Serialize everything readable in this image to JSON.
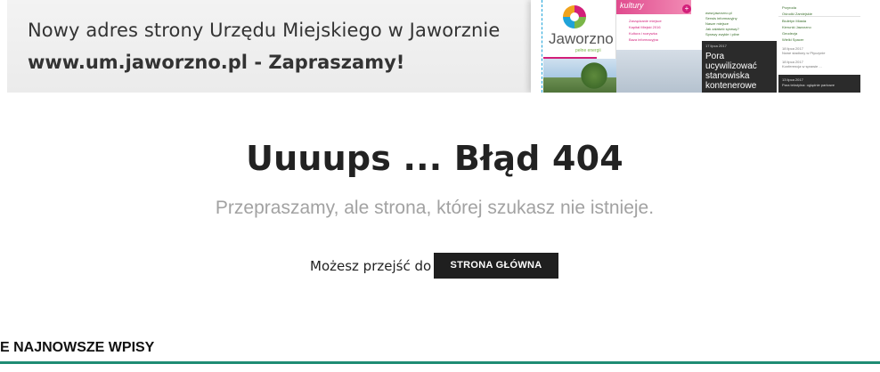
{
  "banner": {
    "line1": "Nowy adres strony Urzędu Miejskiego w Jaworznie",
    "line2": "www.um.jaworzno.pl - Zapraszamy!",
    "preview": {
      "logo_text": "Jaworzno",
      "logo_tagline": "pełne energii",
      "pink_tab": "kultury",
      "mid_links": [
        "Zarządzanie miejsce",
        "Kapitał Miejski 2016",
        "Kultura i rozrywka",
        "Baza informacyjna"
      ],
      "mid_links_right": [
        "www.jaworzno.pl",
        "Serwis informacyjny",
        "Nasze miejsce",
        "Jak załatwić sprawę?",
        "Sprawy zwykłe i pilne"
      ],
      "news_date": "17 lipca 2017",
      "news_title": "Pora ucywilizować stanowiska kontenerowe",
      "right_items": [
        "Przyroda",
        "Ośrodki Zamiejskie",
        "Biuletyn Miasta",
        "Kierunki Jaworzno",
        "Geodezja",
        "Wielki Spacer"
      ],
      "right_news": [
        "18 lipca 2017",
        "Nowe stadiony w Ptyczynie",
        "18 lipca 2017",
        "Konferencja w sprawie ..."
      ],
      "right_dark": [
        "13 lipca 2017",
        "Para tekstylna: oglądnie parkowe"
      ]
    }
  },
  "error": {
    "title": "Uuuups ... Błąd 404",
    "subtitle": "Przepraszamy, ale strona, której szukasz nie istnieje.",
    "go_text": "Możesz przejść do",
    "home_button": "STRONA GŁÓWNA"
  },
  "latest": {
    "heading": "E NAJNOWSZE WPISY"
  },
  "colors": {
    "accent_line": "#1e8c74",
    "button_bg": "#1f1f1f",
    "subtitle_gray": "#a2a2a2",
    "brand_pink": "#d21f7a"
  }
}
